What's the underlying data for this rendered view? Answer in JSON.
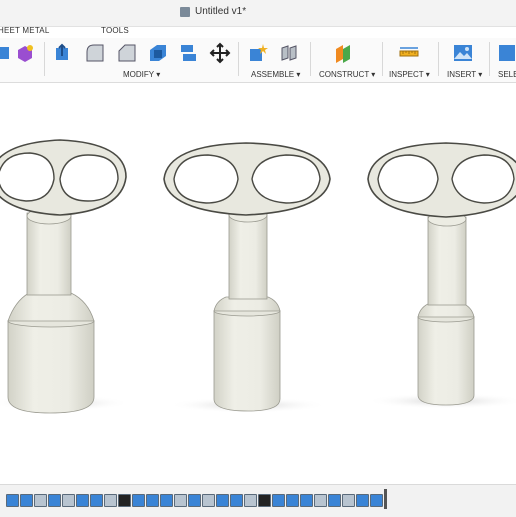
{
  "document": {
    "title": "Untitled v1*"
  },
  "tabs": {
    "sheet_metal": "HEET METAL",
    "tools": "TOOLS"
  },
  "toolbar": {
    "modify_label": "MODIFY ▾",
    "assemble_label": "ASSEMBLE ▾",
    "construct_label": "CONSTRUCT ▾",
    "inspect_label": "INSPECT ▾",
    "insert_label": "INSERT ▾",
    "select_label": "SELE"
  },
  "icons": {
    "modify": [
      "press-pull-icon",
      "fillet-icon",
      "chamfer-icon",
      "shell-icon",
      "combine-icon",
      "move-icon"
    ],
    "assemble": [
      "new-component-icon",
      "joint-icon"
    ],
    "construct": [
      "offset-plane-icon"
    ],
    "inspect": [
      "measure-icon"
    ],
    "insert": [
      "insert-image-icon"
    ]
  },
  "viewport": {
    "model": "three-key-bodies",
    "background": "#ffffff",
    "body_color": "#e8e8df"
  },
  "timeline": {
    "feature_count": 27
  }
}
